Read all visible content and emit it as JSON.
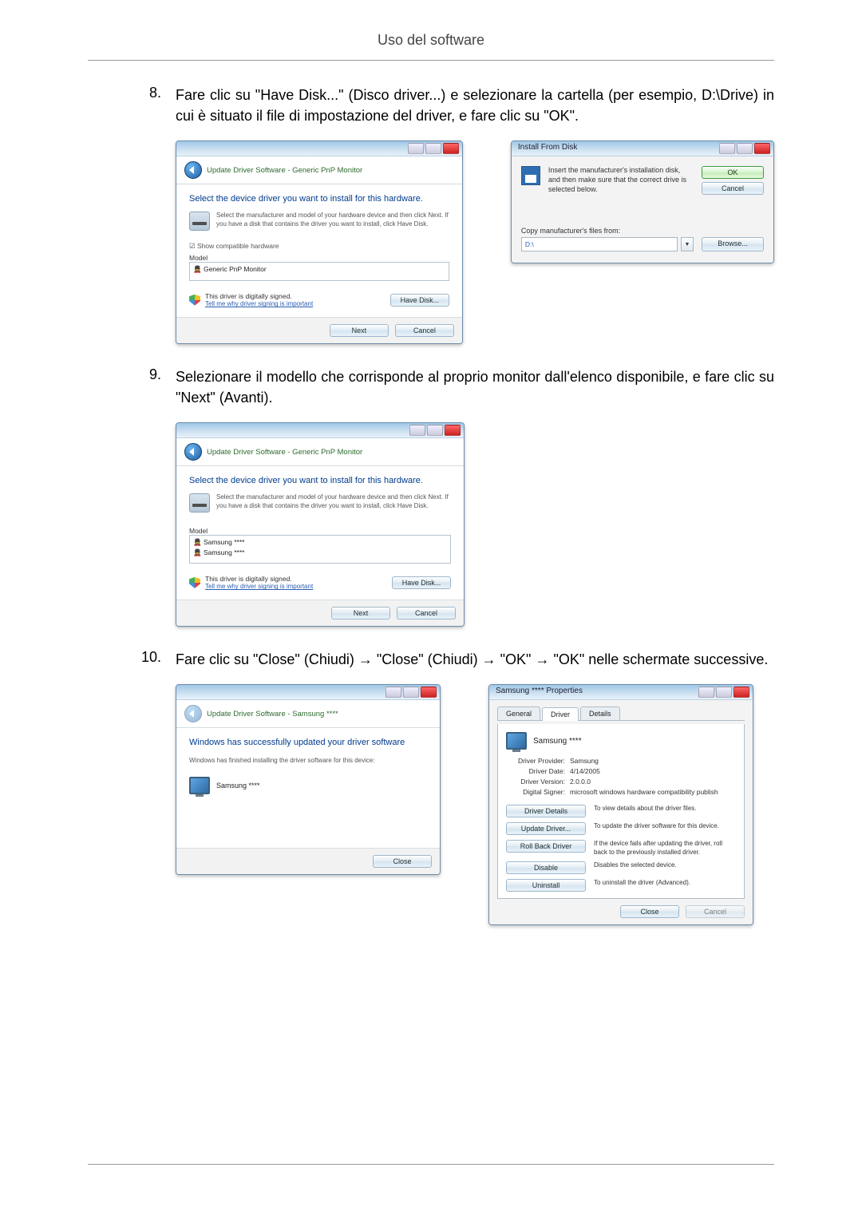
{
  "header": {
    "title": "Uso del software"
  },
  "steps": {
    "s8": {
      "num": "8.",
      "text": "Fare clic su \"Have Disk...\" (Disco driver...) e selezionare la cartella (per esempio, D:\\Drive) in cui è situato il file di impostazione del driver, e fare clic su \"OK\"."
    },
    "s9": {
      "num": "9.",
      "text": "Selezionare il modello che corrisponde al proprio monitor dall'elenco disponibile, e fare clic su \"Next\" (Avanti)."
    },
    "s10": {
      "num": "10.",
      "text": "Fare clic su \"Close\" (Chiudi) → \"Close\" (Chiudi) → \"OK\" → \"OK\" nelle schermate successive."
    }
  },
  "dlg_update1": {
    "breadcrumb": "Update Driver Software - Generic PnP Monitor",
    "heading": "Select the device driver you want to install for this hardware.",
    "subtext": "Select the manufacturer and model of your hardware device and then click Next. If you have a disk that contains the driver you want to install, click Have Disk.",
    "compat_checkbox": "Show compatible hardware",
    "model_label": "Model",
    "model_item": "Generic PnP Monitor",
    "signed_text": "This driver is digitally signed.",
    "signed_link": "Tell me why driver signing is important",
    "have_disk": "Have Disk...",
    "next": "Next",
    "cancel": "Cancel"
  },
  "dlg_install_from_disk": {
    "title": "Install From Disk",
    "instruction": "Insert the manufacturer's installation disk, and then make sure that the correct drive is selected below.",
    "ok": "OK",
    "cancel": "Cancel",
    "copy_label": "Copy manufacturer's files from:",
    "path": "D:\\",
    "browse": "Browse..."
  },
  "dlg_update2": {
    "breadcrumb": "Update Driver Software - Generic PnP Monitor",
    "heading": "Select the device driver you want to install for this hardware.",
    "subtext": "Select the manufacturer and model of your hardware device and then click Next. If you have a disk that contains the driver you want to install, click Have Disk.",
    "model_label": "Model",
    "model_item_a": "Samsung ****",
    "model_item_b": "Samsung ****",
    "signed_text": "This driver is digitally signed.",
    "signed_link": "Tell me why driver signing is important",
    "have_disk": "Have Disk...",
    "next": "Next",
    "cancel": "Cancel"
  },
  "dlg_update_done": {
    "breadcrumb": "Update Driver Software - Samsung ****",
    "heading": "Windows has successfully updated your driver software",
    "subtext": "Windows has finished installing the driver software for this device:",
    "device": "Samsung ****",
    "close": "Close"
  },
  "dlg_props": {
    "title": "Samsung **** Properties",
    "tabs": {
      "general": "General",
      "driver": "Driver",
      "details": "Details"
    },
    "device_name": "Samsung ****",
    "rows": {
      "provider_k": "Driver Provider:",
      "provider_v": "Samsung",
      "date_k": "Driver Date:",
      "date_v": "4/14/2005",
      "version_k": "Driver Version:",
      "version_v": "2.0.0.0",
      "signer_k": "Digital Signer:",
      "signer_v": "microsoft windows hardware compatibility publish"
    },
    "btns": {
      "details": "Driver Details",
      "details_d": "To view details about the driver files.",
      "update": "Update Driver...",
      "update_d": "To update the driver software for this device.",
      "rollback": "Roll Back Driver",
      "rollback_d": "If the device fails after updating the driver, roll back to the previously installed driver.",
      "disable": "Disable",
      "disable_d": "Disables the selected device.",
      "uninstall": "Uninstall",
      "uninstall_d": "To uninstall the driver (Advanced)."
    },
    "close": "Close",
    "cancel": "Cancel"
  }
}
